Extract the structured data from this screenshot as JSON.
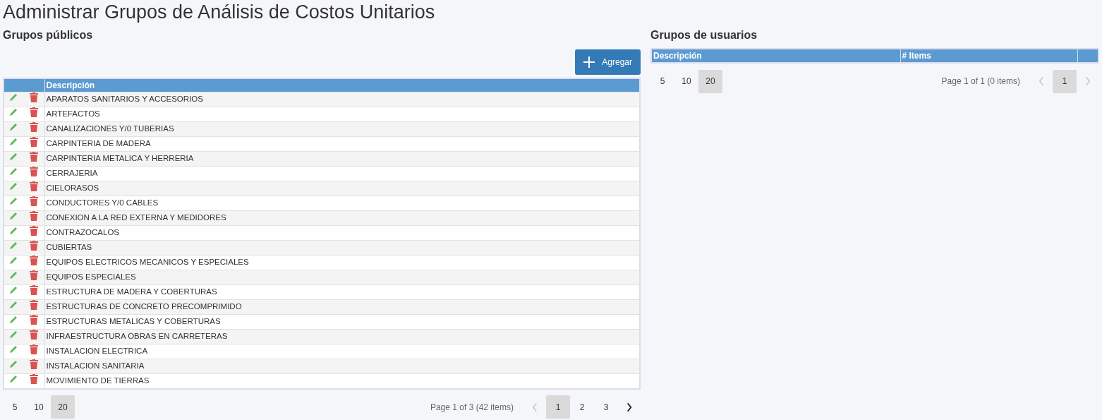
{
  "page_title": "Administrar Grupos de Análisis de Costos Unitarios",
  "public_groups": {
    "title": "Grupos públicos",
    "add_button": "Agregar",
    "columns": [
      "Descripción"
    ],
    "rows": [
      {
        "description": "APARATOS SANITARIOS Y ACCESORIOS"
      },
      {
        "description": "ARTEFACTOS"
      },
      {
        "description": "CANALIZACIONES Y/0 TUBERIAS"
      },
      {
        "description": "CARPINTERIA DE MADERA"
      },
      {
        "description": "CARPINTERIA METALICA Y HERRERIA"
      },
      {
        "description": "CERRAJERIA"
      },
      {
        "description": "CIELORASOS"
      },
      {
        "description": "CONDUCTORES Y/0 CABLES"
      },
      {
        "description": "CONEXION A LA RED EXTERNA Y MEDIDORES"
      },
      {
        "description": "CONTRAZOCALOS"
      },
      {
        "description": "CUBIERTAS"
      },
      {
        "description": "EQUIPOS ELECTRICOS MECANICOS Y ESPECIALES"
      },
      {
        "description": "EQUIPOS ESPECIALES"
      },
      {
        "description": "ESTRUCTURA DE MADERA Y COBERTURAS"
      },
      {
        "description": "ESTRUCTURAS DE CONCRETO PRECOMPRIMIDO"
      },
      {
        "description": "ESTRUCTURAS METALICAS Y COBERTURAS"
      },
      {
        "description": "INFRAESTRUCTURA OBRAS EN CARRETERAS"
      },
      {
        "description": "INSTALACION ELECTRICA"
      },
      {
        "description": "INSTALACION SANITARIA"
      },
      {
        "description": "MOVIMIENTO DE TIERRAS"
      }
    ],
    "pager": {
      "page_sizes": [
        {
          "label": "5",
          "selected": false
        },
        {
          "label": "10",
          "selected": false
        },
        {
          "label": "20",
          "selected": true
        }
      ],
      "summary": "Page 1 of 3 (42 items)",
      "prev": {
        "disabled": true
      },
      "pages": [
        {
          "label": "1",
          "selected": true
        },
        {
          "label": "2",
          "selected": false
        },
        {
          "label": "3",
          "selected": false
        }
      ],
      "next": {
        "disabled": false
      }
    }
  },
  "user_groups": {
    "title": "Grupos de usuarios",
    "columns": [
      "Descripción",
      "# Items"
    ],
    "pager": {
      "page_sizes": [
        {
          "label": "5",
          "selected": false
        },
        {
          "label": "10",
          "selected": false
        },
        {
          "label": "20",
          "selected": true
        }
      ],
      "summary": "Page 1 of 1 (0 items)",
      "prev": {
        "disabled": true
      },
      "pages": [
        {
          "label": "1",
          "selected": true
        }
      ],
      "next": {
        "disabled": true
      }
    }
  }
}
